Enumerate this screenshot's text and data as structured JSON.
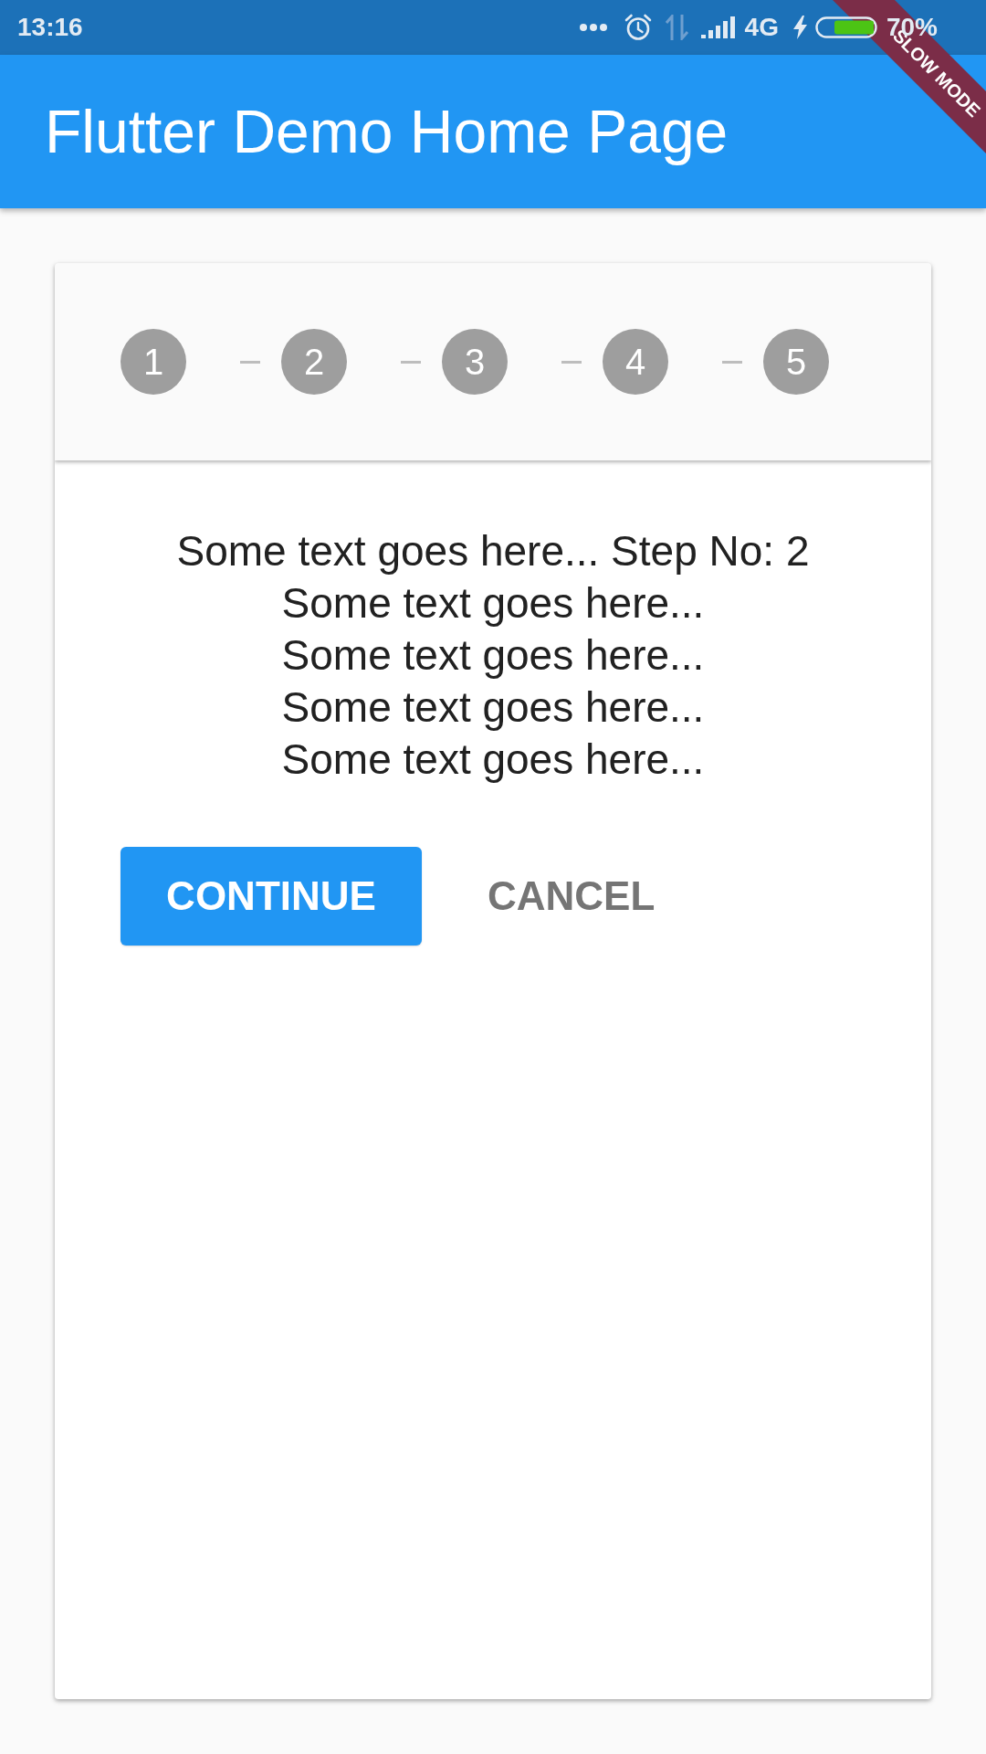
{
  "status_bar": {
    "time": "13:16",
    "network": "4G",
    "battery": "70%"
  },
  "debug_banner": {
    "label": "SLOW MODE"
  },
  "app_bar": {
    "title": "Flutter Demo Home Page"
  },
  "stepper": {
    "steps": [
      {
        "number": "1"
      },
      {
        "number": "2"
      },
      {
        "number": "3"
      },
      {
        "number": "4"
      },
      {
        "number": "5"
      }
    ],
    "content": {
      "lines": [
        "Some text goes here... Step No: 2",
        "Some text goes here...",
        "Some text goes here...",
        "Some text goes here...",
        "Some text goes here..."
      ]
    },
    "buttons": [
      {
        "label": "CONTINUE",
        "kind": "primary"
      },
      {
        "label": "CANCEL",
        "kind": "flat"
      }
    ]
  }
}
